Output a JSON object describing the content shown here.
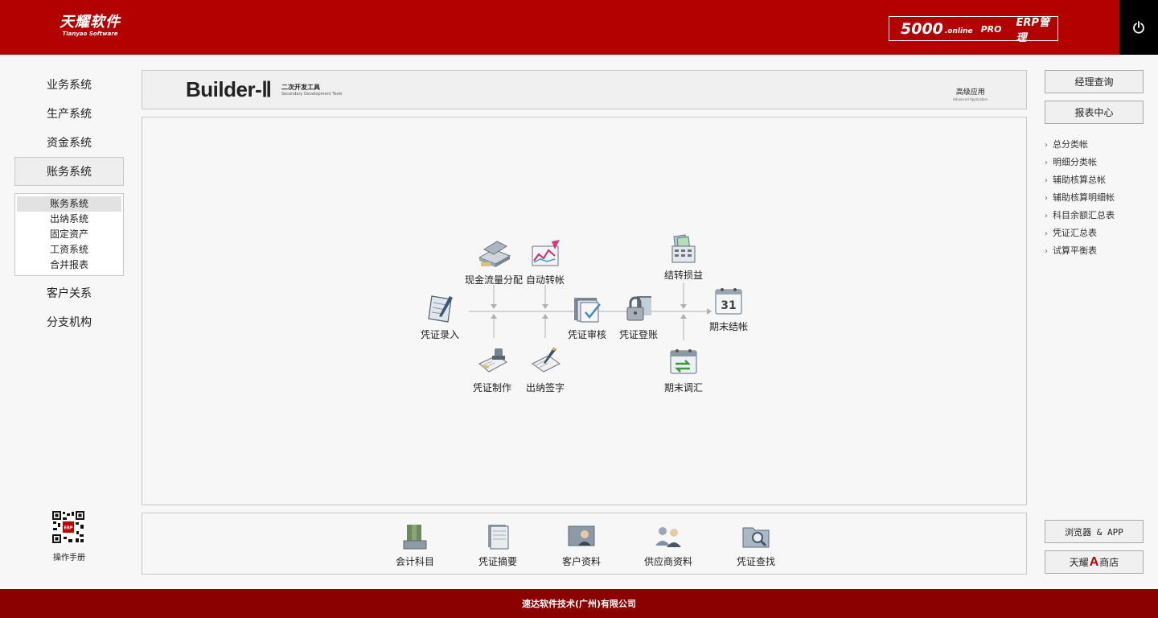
{
  "header": {
    "logo_main": "天耀软件",
    "logo_sub": "Tianyao Software",
    "product_num": "5000",
    "product_online": ".online",
    "product_pro": "PRO",
    "product_erp": "ERP管理",
    "brand_color": "#b30000"
  },
  "sidebar": {
    "items": [
      {
        "label": "业务系统"
      },
      {
        "label": "生产系统"
      },
      {
        "label": "资金系统"
      },
      {
        "label": "账务系统"
      },
      {
        "label": "客户关系"
      },
      {
        "label": "分支机构"
      }
    ],
    "active": "账务系统",
    "submenu": [
      "账务系统",
      "出纳系统",
      "固定资产",
      "工资系统",
      "合并报表"
    ],
    "manual_label": "操作手册"
  },
  "banner": {
    "title": "Builder-Ⅱ",
    "subtitle_cn": "二次开发工具",
    "subtitle_en": "Secondary Development Tools",
    "adv_cn": "高级应用",
    "adv_en": "Advanced Application"
  },
  "workflow": {
    "voucher_entry": "凭证录入",
    "cashflow": "现金流量分配",
    "auto_transfer": "自动转帐",
    "voucher_make": "凭证制作",
    "cashier_sign": "出纳签字",
    "voucher_audit": "凭证审核",
    "voucher_post": "凭证登账",
    "carry_pl": "结转损益",
    "period_fx": "期末调汇",
    "period_close": "期末结帐"
  },
  "tools": [
    "会计科目",
    "凭证摘要",
    "客户资料",
    "供应商资料",
    "凭证查找"
  ],
  "right": {
    "manager_query": "经理查询",
    "report_center": "报表中心",
    "reports": [
      "总分类帐",
      "明细分类帐",
      "辅助核算总帐",
      "辅助核算明细帐",
      "科目余额汇总表",
      "凭证汇总表",
      "试算平衡表"
    ],
    "browser_app": "浏览器 & APP",
    "store_pre": "天耀",
    "store_a": "A",
    "store_post": "商店"
  },
  "footer": {
    "company": "速达软件技术(广州)有限公司"
  }
}
